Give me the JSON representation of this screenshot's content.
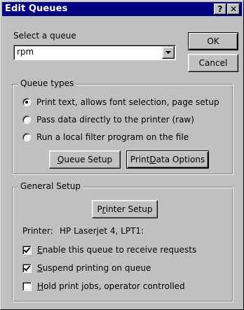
{
  "window": {
    "title": "Edit Queues",
    "help_glyph": "?",
    "close_glyph": "✕"
  },
  "queue_select": {
    "label": "Select a queue",
    "value": "rpm"
  },
  "buttons": {
    "ok": "OK",
    "cancel": "Cancel",
    "queue_setup": {
      "pre": "",
      "mn": "Q",
      "post": "ueue Setup"
    },
    "print_data_options": {
      "pre": "Print ",
      "mn": "D",
      "post": "ata Options"
    },
    "printer_setup": {
      "pre": "P",
      "mn": "r",
      "post": "inter Setup"
    }
  },
  "queue_types": {
    "title": "Queue types",
    "options": [
      {
        "label": "Print text, allows font selection, page setup",
        "selected": true
      },
      {
        "label": "Pass data directly to the printer (raw)",
        "selected": false
      },
      {
        "label": "Run a local filter program on the file",
        "selected": false
      }
    ]
  },
  "general_setup": {
    "title": "General Setup",
    "printer_label": "Printer:",
    "printer_value": "HP Laserjet 4, LPT1:",
    "checkboxes": [
      {
        "mn": "E",
        "post": "nable this queue to receive requests",
        "checked": true
      },
      {
        "mn": "S",
        "post": "uspend printing on queue",
        "checked": true
      },
      {
        "mn": "H",
        "post": "old print jobs, operator controlled",
        "checked": false
      }
    ]
  }
}
